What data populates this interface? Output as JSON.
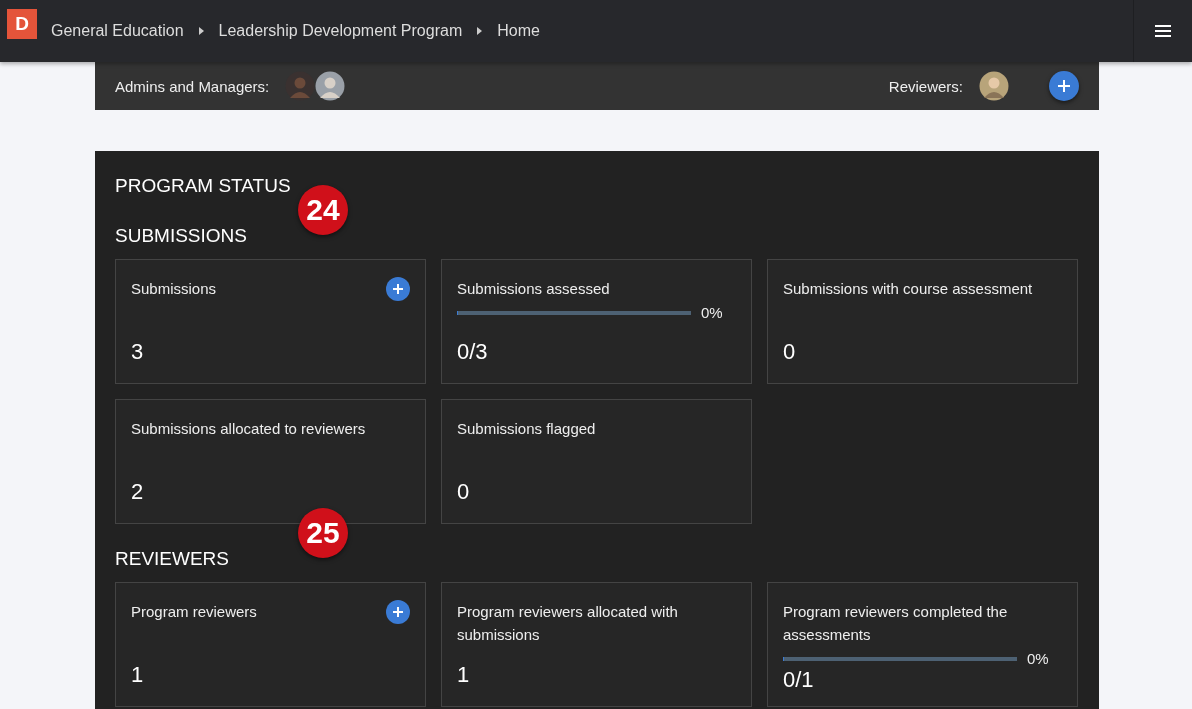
{
  "header": {
    "logo": "D",
    "breadcrumbs": [
      "General Education",
      "Leadership Development Program",
      "Home"
    ]
  },
  "people_bar": {
    "admins_label": "Admins and Managers:",
    "admins": [
      {
        "kind": "avatar"
      },
      {
        "kind": "avatar"
      }
    ],
    "reviewers_label": "Reviewers:",
    "reviewers": [
      {
        "kind": "avatar"
      }
    ]
  },
  "title": "PROGRAM STATUS",
  "sections": [
    {
      "heading": "SUBMISSIONS",
      "marker": "24",
      "cards": [
        {
          "title": "Submissions",
          "value": "3",
          "add_button": true
        },
        {
          "title": "Submissions assessed",
          "value": "0/3",
          "level": 0,
          "reading": "0%"
        },
        {
          "title": "Submissions with course assessment",
          "value": "0"
        },
        {
          "title": "Submissions allocated to reviewers",
          "value": "2"
        },
        {
          "title": "Submissions flagged",
          "value": "0"
        }
      ]
    },
    {
      "heading": "REVIEWERS",
      "marker": "25",
      "cards": [
        {
          "title": "Program reviewers",
          "value": "1",
          "add_button": true
        },
        {
          "title": "Program reviewers allocated with submissions",
          "value": "1"
        },
        {
          "title": "Program reviewers completed the assessments",
          "value": "0/1",
          "level": 0,
          "reading": "0%"
        }
      ]
    }
  ]
}
